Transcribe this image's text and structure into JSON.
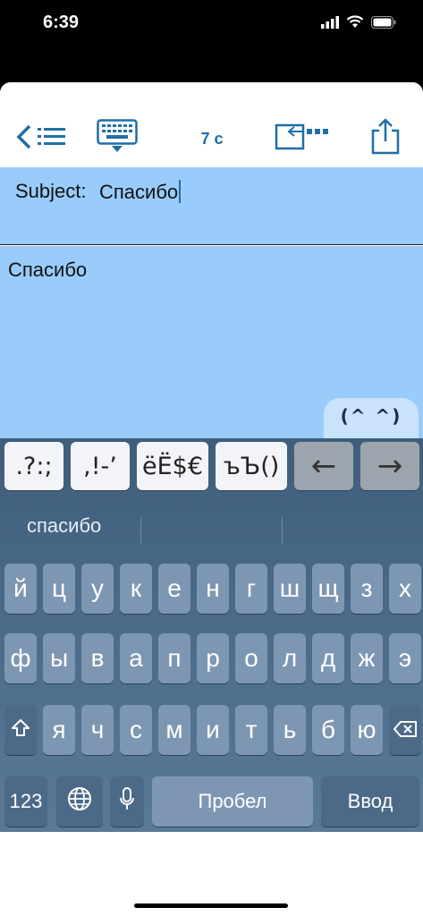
{
  "status_bar": {
    "time": "6:39"
  },
  "toolbar": {
    "char_count": "7 c"
  },
  "subject": {
    "label": "Subject:",
    "value": "Спасибо"
  },
  "body": {
    "text": "Спасибо"
  },
  "smiley_tab": {
    "label": "(^ ^)"
  },
  "symbol_row": [
    ".?:;",
    ",!-’",
    "ëË$€",
    "ъЪ()",
    "←",
    "→"
  ],
  "suggestion": {
    "word": "спасибо"
  },
  "keyboard": {
    "row1": [
      "й",
      "ц",
      "у",
      "к",
      "е",
      "н",
      "г",
      "ш",
      "щ",
      "з",
      "х"
    ],
    "row2": [
      "ф",
      "ы",
      "в",
      "а",
      "п",
      "р",
      "о",
      "л",
      "д",
      "ж",
      "э"
    ],
    "row3": [
      "я",
      "ч",
      "с",
      "м",
      "и",
      "т",
      "ь",
      "б",
      "ю"
    ],
    "numbers_label": "123",
    "space_label": "Пробел",
    "return_label": "Ввод"
  }
}
